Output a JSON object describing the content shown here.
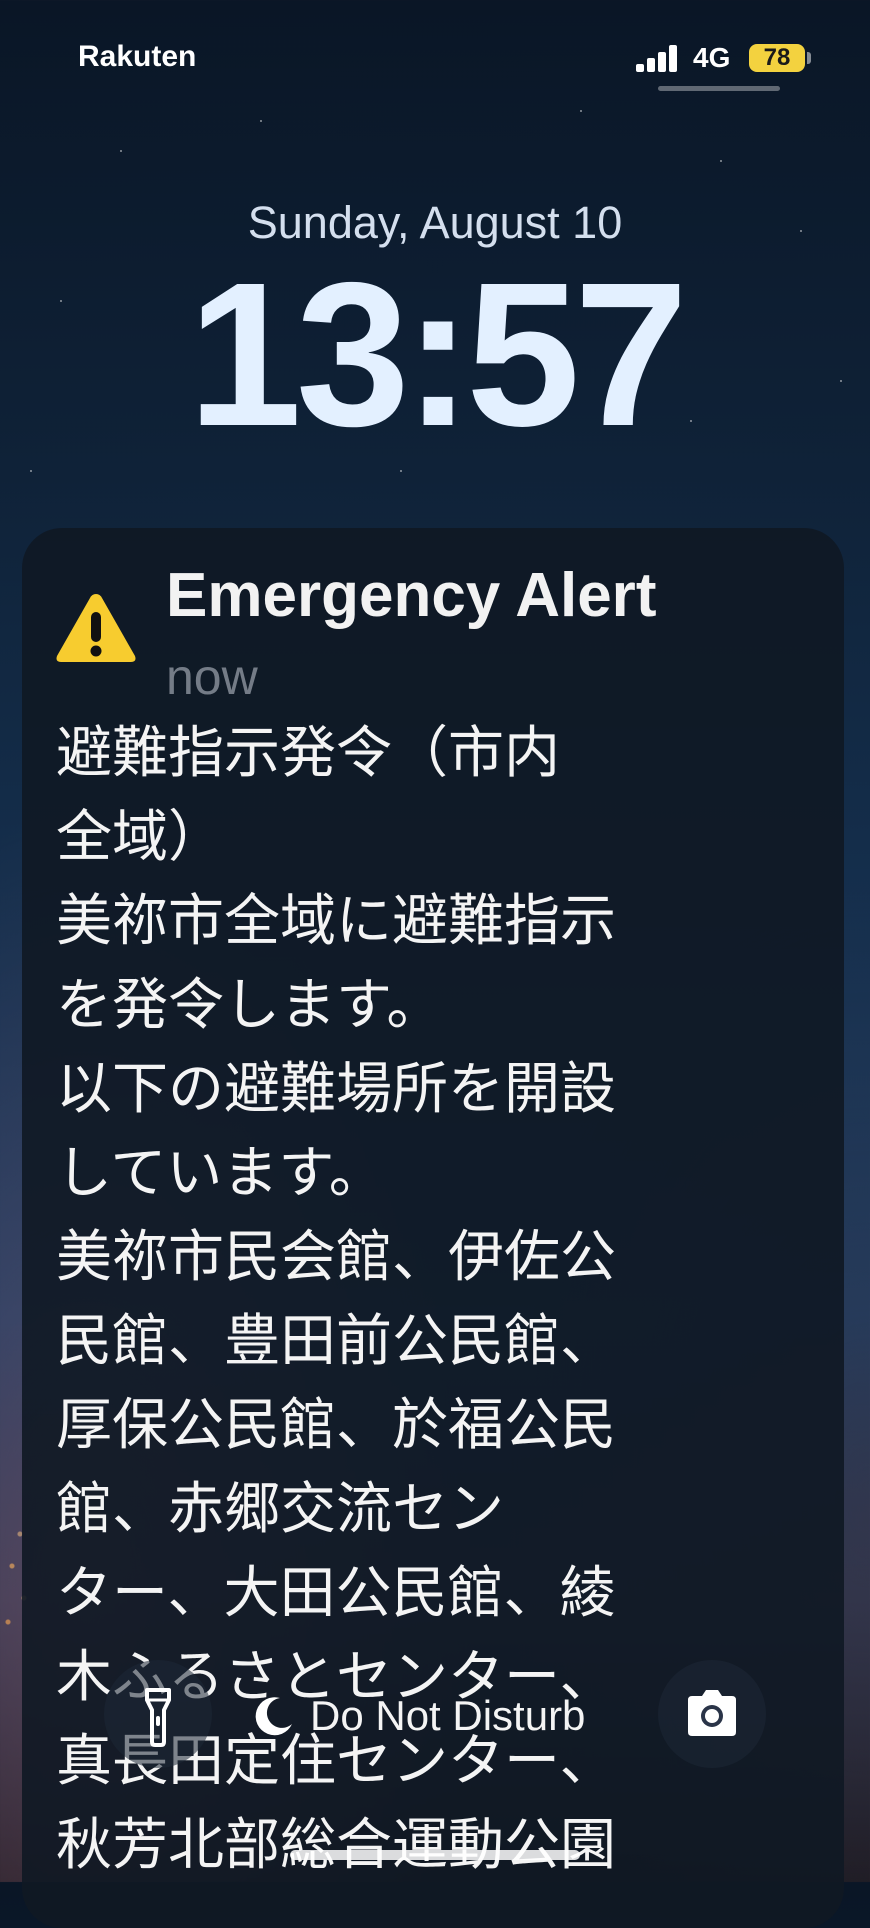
{
  "status_bar": {
    "carrier": "Rakuten",
    "network": "4G",
    "battery": "78",
    "battery_color": "#f3d23f"
  },
  "lock_screen": {
    "date": "Sunday, August 10",
    "time": "13:57"
  },
  "notification": {
    "icon": "warning-triangle-icon",
    "title": "Emergency Alert",
    "time": "now",
    "body_lines": [
      "避難指示発令（市内",
      "全域）",
      "美祢市全域に避難指示",
      "を発令します。",
      "以下の避難場所を開設",
      "しています。",
      "美祢市民会館、伊佐公",
      "民館、豊田前公民館、",
      "厚保公民館、於福公民",
      "館、赤郷交流セン",
      "ター、大田公民館、綾",
      "木ふるさとセンター、",
      "真長田定住センター、",
      "秋芳北部総合運動公園"
    ]
  },
  "controls": {
    "flashlight_icon": "flashlight-icon",
    "dnd_icon": "moon-icon",
    "dnd_label": "Do Not Disturb",
    "camera_icon": "camera-icon"
  }
}
